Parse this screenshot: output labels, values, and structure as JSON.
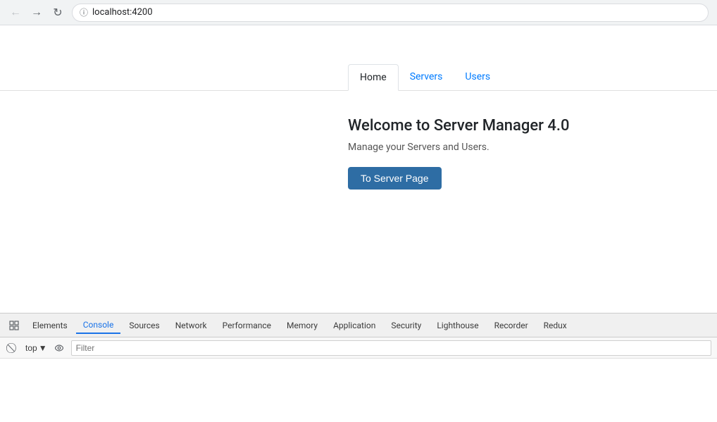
{
  "browser": {
    "url": "localhost:4200",
    "back_disabled": true,
    "forward_disabled": false
  },
  "app": {
    "nav": {
      "tabs": [
        {
          "label": "Home",
          "active": true,
          "type": "default"
        },
        {
          "label": "Servers",
          "active": false,
          "type": "link"
        },
        {
          "label": "Users",
          "active": false,
          "type": "link"
        }
      ]
    },
    "home": {
      "title": "Welcome to Server Manager 4.0",
      "subtitle": "Manage your Servers and Users.",
      "button_label": "To Server Page"
    }
  },
  "devtools": {
    "tabs": [
      {
        "label": "Elements",
        "active": false
      },
      {
        "label": "Console",
        "active": true
      },
      {
        "label": "Sources",
        "active": false
      },
      {
        "label": "Network",
        "active": false
      },
      {
        "label": "Performance",
        "active": false
      },
      {
        "label": "Memory",
        "active": false
      },
      {
        "label": "Application",
        "active": false
      },
      {
        "label": "Security",
        "active": false
      },
      {
        "label": "Lighthouse",
        "active": false
      },
      {
        "label": "Recorder",
        "active": false
      },
      {
        "label": "Redux",
        "active": false
      }
    ],
    "toolbar": {
      "context_selector": "top",
      "filter_placeholder": "Filter"
    }
  }
}
